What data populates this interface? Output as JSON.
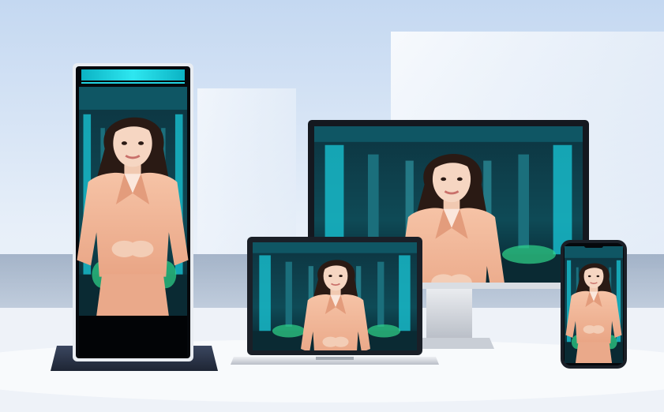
{
  "scene": {
    "description_kind": "product-showcase",
    "devices": [
      {
        "id": "kiosk",
        "kind": "vertical-standing-kiosk-display"
      },
      {
        "id": "monitor",
        "kind": "desktop-monitor"
      },
      {
        "id": "laptop",
        "kind": "laptop"
      },
      {
        "id": "phone",
        "kind": "smartphone"
      }
    ],
    "colors": {
      "sky_top": "#c9dcf3",
      "sky_bottom": "#eaf1fa",
      "floor": "#eef2f8",
      "screen_teal": "#18c7d6",
      "screen_dark": "#0b2a3a",
      "jacket": "#f2b89a",
      "hair": "#2a1a14",
      "device_frame": "#1a1f29",
      "base": "#2f3a4f",
      "silver": "#d7dbe2"
    }
  }
}
